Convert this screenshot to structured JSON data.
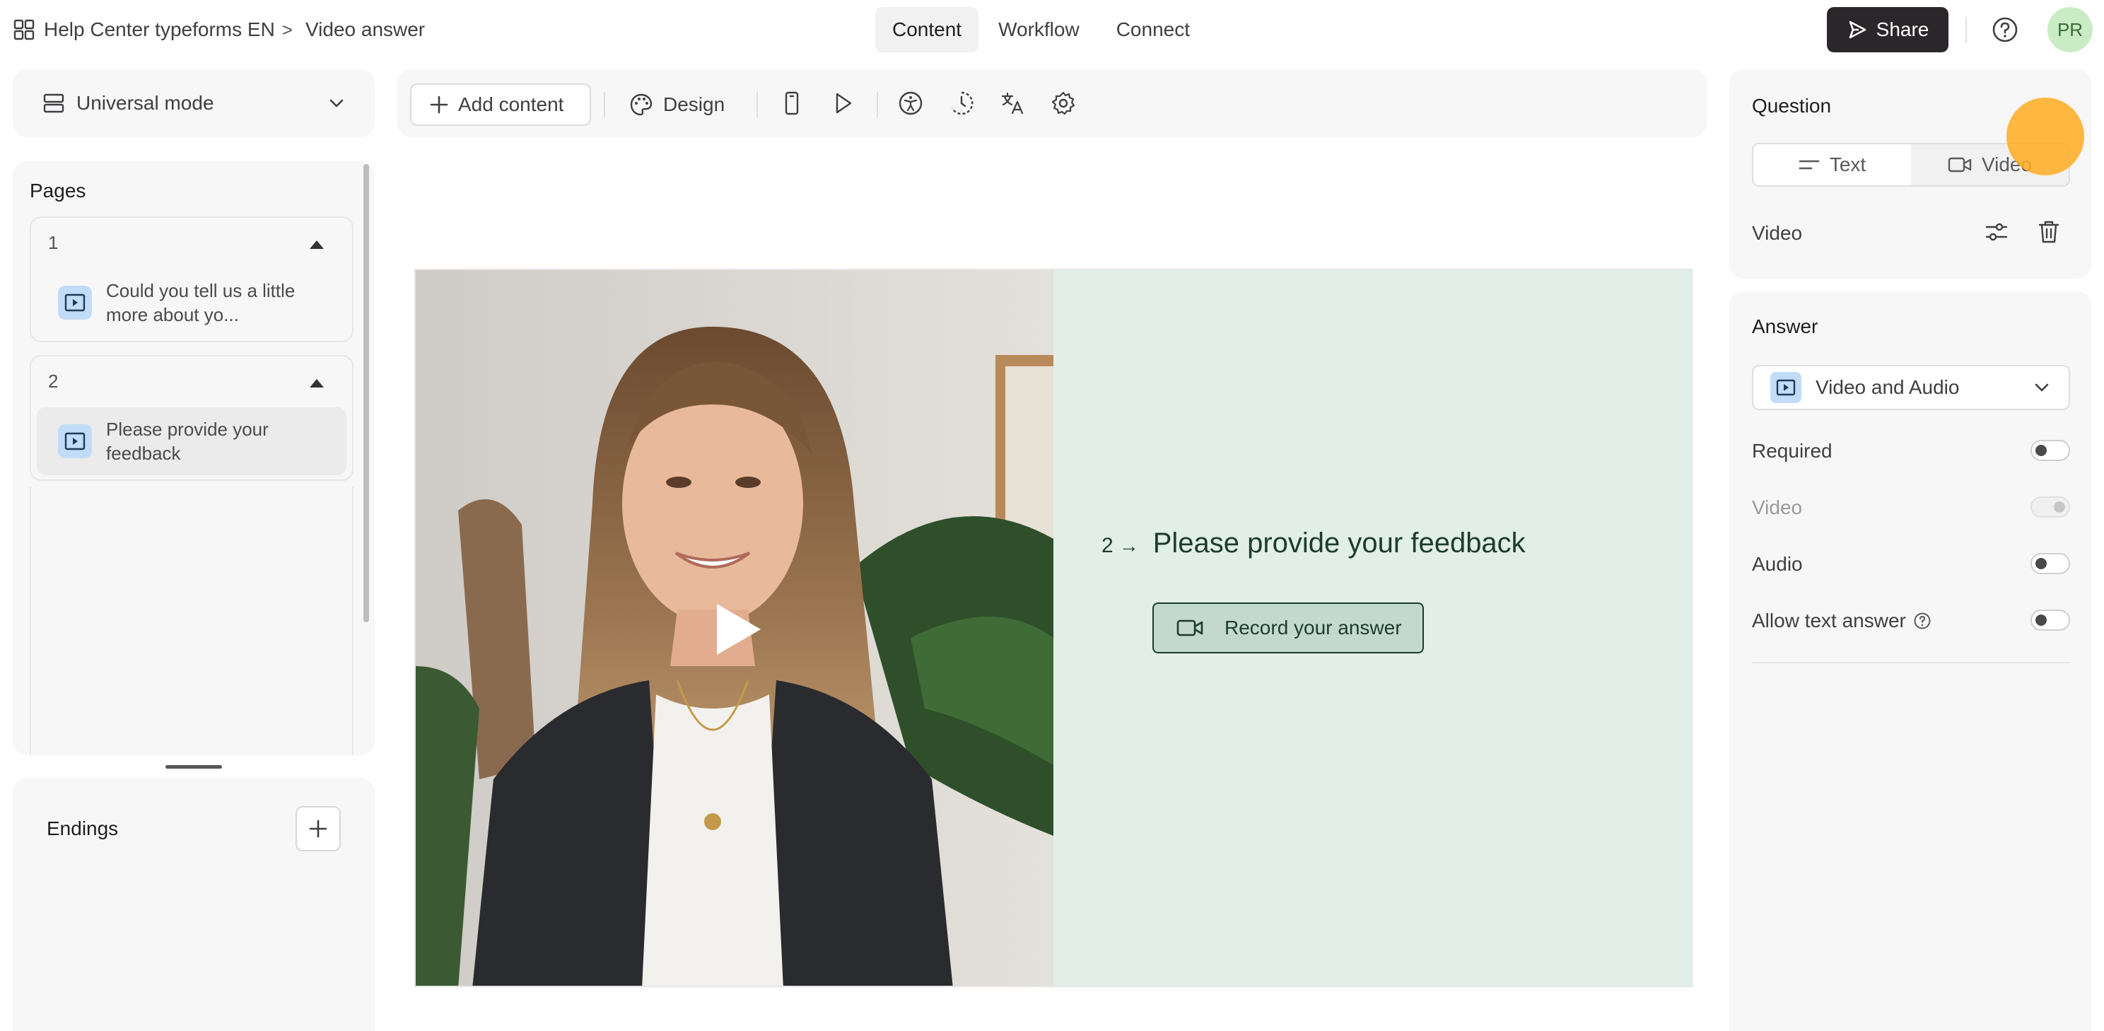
{
  "header": {
    "workspace": "Help Center typeforms EN",
    "separator": ">",
    "form_title": "Video answer",
    "tabs": [
      {
        "label": "Content",
        "active": true
      },
      {
        "label": "Workflow",
        "active": false
      },
      {
        "label": "Connect",
        "active": false
      }
    ],
    "share_label": "Share",
    "avatar_initials": "PR"
  },
  "left": {
    "mode_label": "Universal mode",
    "pages_title": "Pages",
    "pages": [
      {
        "number": "1",
        "item_text": "Could you tell us a little more about yo..."
      },
      {
        "number": "2",
        "item_text": "Please provide your feedback"
      }
    ],
    "endings_title": "Endings"
  },
  "toolbar": {
    "add_content_label": "Add content",
    "design_label": "Design",
    "icons": [
      "mobile-preview-icon",
      "play-preview-icon",
      "accessibility-icon",
      "loading-icon",
      "translate-icon",
      "settings-gear-icon"
    ]
  },
  "canvas": {
    "question_number": "2",
    "question_arrow": "→",
    "question_text": "Please provide your feedback",
    "record_label": "Record your answer",
    "background_color": "#e1efe8",
    "accent_color": "#1d3b30"
  },
  "right": {
    "question_title": "Question",
    "question_type_options": [
      "Text",
      "Video"
    ],
    "video_label": "Video",
    "answer_title": "Answer",
    "answer_type": "Video and Audio",
    "settings": [
      {
        "label": "Required",
        "enabled": false,
        "disabled": false
      },
      {
        "label": "Video",
        "enabled": true,
        "disabled": true
      },
      {
        "label": "Audio",
        "enabled": false,
        "disabled": false
      },
      {
        "label": "Allow text answer",
        "enabled": false,
        "disabled": false
      }
    ]
  }
}
